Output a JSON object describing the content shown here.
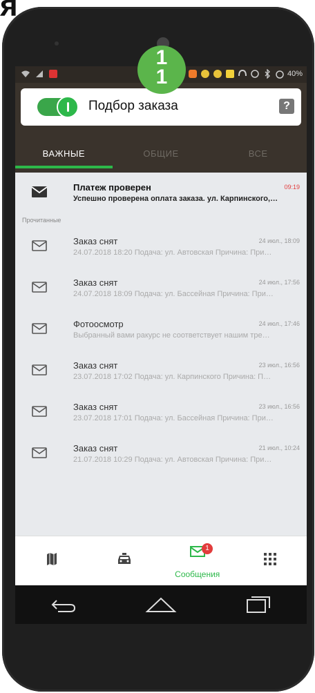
{
  "corner_text": "я",
  "overlay": {
    "line1": "1",
    "line2": "1"
  },
  "statusbar": {
    "battery": "40%"
  },
  "header": {
    "toggle_label": "Подбор заказа",
    "help_label": "?",
    "toggle_on": true
  },
  "tabs": [
    {
      "label": "ВАЖНЫЕ",
      "active": true
    },
    {
      "label": "ОБЩИЕ",
      "active": false
    },
    {
      "label": "ВСЕ",
      "active": false
    }
  ],
  "messages": {
    "unread": [
      {
        "title": "Платеж проверен",
        "time": "09:19",
        "text": "Успешно проверена оплата заказа. ул. Карпинского,…"
      }
    ],
    "read_label": "Прочитанные",
    "read": [
      {
        "title": "Заказ снят",
        "time": "24 июл., 18:09",
        "text": "24.07.2018 18:20 Подача: ул. Автовская  Причина: При…"
      },
      {
        "title": "Заказ снят",
        "time": "24 июл., 17:56",
        "text": "24.07.2018 18:09 Подача: ул. Бассейная  Причина: При…"
      },
      {
        "title": "Фотоосмотр",
        "time": "24 июл., 17:46",
        "text": "Выбранный вами ракурс не соответствует нашим тре…"
      },
      {
        "title": "Заказ снят",
        "time": "23 июл., 16:56",
        "text": "23.07.2018 17:02 Подача: ул. Карпинского  Причина: П…"
      },
      {
        "title": "Заказ снят",
        "time": "23 июл., 16:56",
        "text": "23.07.2018 17:01 Подача: ул. Бассейная  Причина: При…"
      },
      {
        "title": "Заказ снят",
        "time": "21 июл., 10:24",
        "text": "21.07.2018 10:29 Подача: ул. Автовская  Причина: При…"
      }
    ]
  },
  "bottom_nav": {
    "items": [
      {
        "icon": "map-icon"
      },
      {
        "icon": "taxi-icon"
      },
      {
        "icon": "mail-icon",
        "label": "Сообщения",
        "badge": "1",
        "active": true
      },
      {
        "icon": "grid-icon"
      }
    ]
  },
  "colors": {
    "accent": "#2db84a",
    "header_bg": "#3a332c",
    "alert": "#e23c3c"
  }
}
